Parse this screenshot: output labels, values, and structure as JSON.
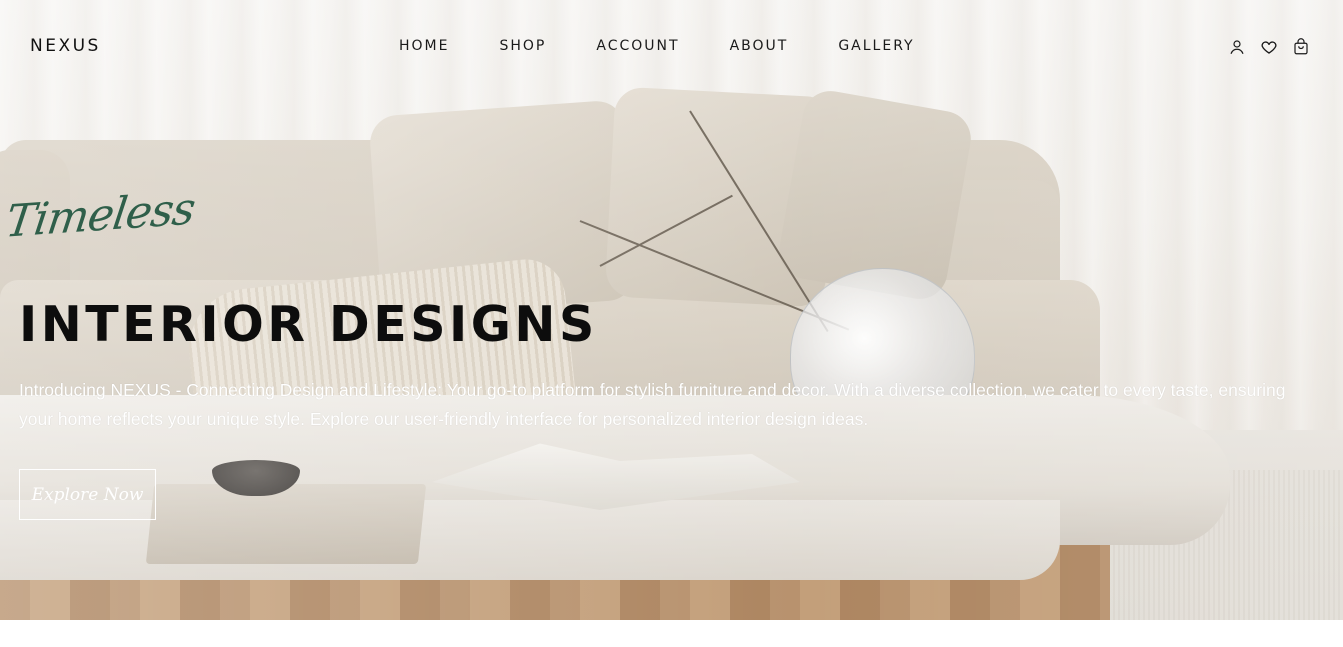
{
  "header": {
    "logo": "NEXUS",
    "nav": [
      {
        "label": "HOME"
      },
      {
        "label": "SHOP"
      },
      {
        "label": "ACCOUNT"
      },
      {
        "label": "ABOUT"
      },
      {
        "label": "GALLERY"
      }
    ],
    "icons": [
      "user-icon",
      "heart-icon",
      "cart-icon"
    ]
  },
  "hero": {
    "script_word": "Timeless",
    "headline": "INTERIOR DESIGNS",
    "intro": "Introducing NEXUS - Connecting Design and Lifestyle: Your go-to platform for stylish furniture and decor. With a diverse collection, we cater to every taste, ensuring your home reflects your unique style. Explore our user-friendly interface for personalized interior design ideas.",
    "cta_label": "Explore Now"
  },
  "colors": {
    "script_accent": "#2f5f4a",
    "headline": "#0d0d0d",
    "intro_text": "#ffffff",
    "nav_text": "#1a1a1a"
  }
}
